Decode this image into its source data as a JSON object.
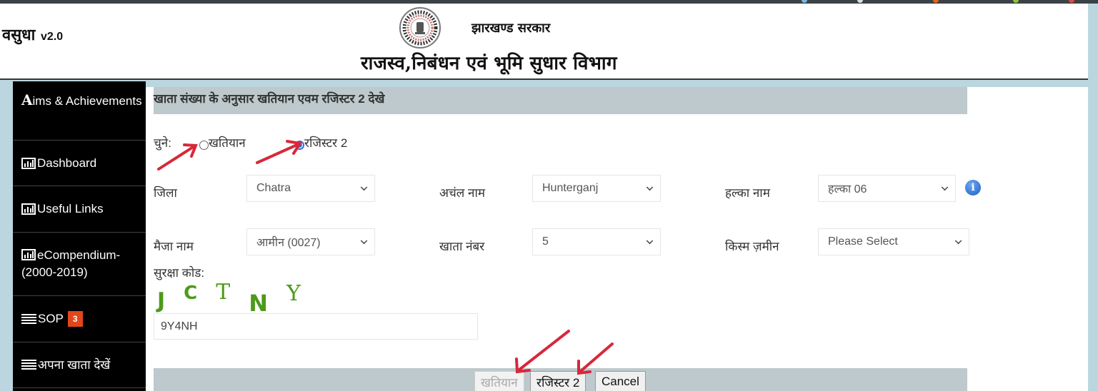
{
  "header": {
    "brand": "वसुधा",
    "version": "v2.0",
    "government": "झारखण्ड सरकार",
    "department": "राजस्व,निबंधन एवं भूमि सुधार  विभाग"
  },
  "sidebar": {
    "items": [
      {
        "icon": "letter-a-icon",
        "label_first": "A",
        "label": "ims & Achievements"
      },
      {
        "icon": "bar-chart-icon",
        "label": "Dashboard"
      },
      {
        "icon": "bar-chart-icon",
        "label": "Useful Links"
      },
      {
        "icon": "bar-chart-icon",
        "label": "eCompendium-(2000-2019)"
      },
      {
        "icon": "list-icon",
        "label": "SOP",
        "badge": "3"
      },
      {
        "icon": "list-icon",
        "label": "अपना खाता देखें"
      }
    ]
  },
  "form": {
    "title": "खाता संख्या के अनुसार खतियान एवम रजिस्टर 2 देखे",
    "choose_label": "चुने:",
    "radio_options": [
      {
        "label": "खतियान",
        "checked": false
      },
      {
        "label": "रजिस्टर 2",
        "checked": true
      }
    ],
    "fields": {
      "district": {
        "label": "जिला",
        "value": "Chatra"
      },
      "circle": {
        "label": "अचंल नाम",
        "value": "Hunterganj"
      },
      "halka": {
        "label": "हल्का नाम",
        "value": "हल्का 06"
      },
      "mauza": {
        "label": "मैजा नाम",
        "value": "आमीन (0027)"
      },
      "khata": {
        "label": "खाता नंबर",
        "value": "5"
      },
      "land_type": {
        "label": "किस्म ज़मीन",
        "value": "Please Select"
      }
    },
    "security_label": "सुरक्षा कोड:",
    "captcha_chars": [
      "J",
      "C",
      "T",
      "N",
      "Y"
    ],
    "security_code_value": "9Y4NH",
    "buttons": {
      "khatiyan": "खतियान",
      "register2": "रजिस्टर 2",
      "cancel": "Cancel"
    }
  },
  "colors": {
    "annotation_arrow": "#d7283a",
    "badge": "#e2461b",
    "captcha": "#4c9a1a"
  }
}
